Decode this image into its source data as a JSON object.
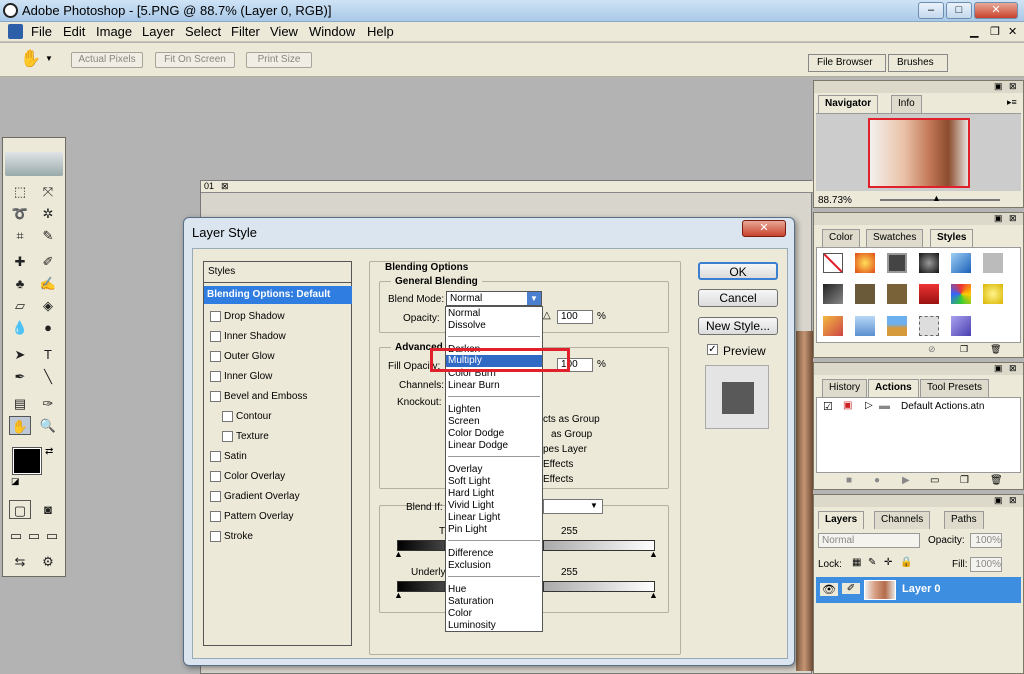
{
  "window": {
    "title": "Adobe Photoshop - [5.PNG @ 88.7% (Layer 0, RGB)]",
    "min": "–",
    "max": "□",
    "close": "✕"
  },
  "menu": [
    "File",
    "Edit",
    "Image",
    "Layer",
    "Select",
    "Filter",
    "View",
    "Window",
    "Help"
  ],
  "options": {
    "actual_pixels": "Actual Pixels",
    "fit_on_screen": "Fit On Screen",
    "print_size": "Print Size"
  },
  "palette_well": {
    "tabs": [
      "File Browser",
      "Brushes"
    ]
  },
  "document": {
    "tab": "01"
  },
  "navigator": {
    "tabs": [
      "Navigator",
      "Info"
    ],
    "zoom": "88.73%"
  },
  "color_panel": {
    "tabs": [
      "Color",
      "Swatches",
      "Styles"
    ]
  },
  "history_panel": {
    "tabs": [
      "History",
      "Actions",
      "Tool Presets"
    ],
    "action": "Default Actions.atn"
  },
  "layers_panel": {
    "tabs": [
      "Layers",
      "Channels",
      "Paths"
    ],
    "blend": "Normal",
    "opacity_label": "Opacity:",
    "opacity": "100%",
    "lock_label": "Lock:",
    "fill_label": "Fill:",
    "fill": "100%",
    "layer_name": "Layer 0"
  },
  "dialog": {
    "title": "Layer Style",
    "styles_header": "Styles",
    "styles": [
      "Blending Options: Default",
      "Drop Shadow",
      "Inner Shadow",
      "Outer Glow",
      "Inner Glow",
      "Bevel and Emboss",
      "Contour",
      "Texture",
      "Satin",
      "Color Overlay",
      "Gradient Overlay",
      "Pattern Overlay",
      "Stroke"
    ],
    "blending_options": "Blending Options",
    "general_blending": "General Blending",
    "blend_mode_label": "Blend Mode:",
    "blend_mode_value": "Normal",
    "opacity_label": "Opacity:",
    "opacity_value": "100",
    "percent": "%",
    "advanced": "Advanced",
    "fill_opacity_label": "Fill Opacity:",
    "fill_opacity_value": "100",
    "channels_label": "Channels:",
    "knockout_label": "Knockout:",
    "opt1": "cts as Group",
    "opt2": "as Group",
    "opt3": "pes Layer",
    "opt4": "Effects",
    "opt5": "Effects",
    "blend_if_label": "Blend If:",
    "this_layer": "This",
    "underlying": "Underlyi",
    "val0": "0",
    "val255a": "255",
    "val255b": "255",
    "ok": "OK",
    "cancel": "Cancel",
    "new_style": "New Style...",
    "preview": "Preview"
  },
  "blend_modes": {
    "group1": [
      "Normal",
      "Dissolve"
    ],
    "group2": [
      "Darken",
      "Multiply",
      "Color Burn",
      "Linear Burn"
    ],
    "group3": [
      "Lighten",
      "Screen",
      "Color Dodge",
      "Linear Dodge"
    ],
    "group4": [
      "Overlay",
      "Soft Light",
      "Hard Light",
      "Vivid Light",
      "Linear Light",
      "Pin Light"
    ],
    "group5": [
      "Difference",
      "Exclusion"
    ],
    "group6": [
      "Hue",
      "Saturation",
      "Color",
      "Luminosity"
    ],
    "highlighted": "Multiply"
  },
  "colors": {
    "highlight": "#316ac5",
    "selected_style": "#2f7de1",
    "annotation": "#e0202a",
    "layer_selected": "#3d8ee0"
  }
}
